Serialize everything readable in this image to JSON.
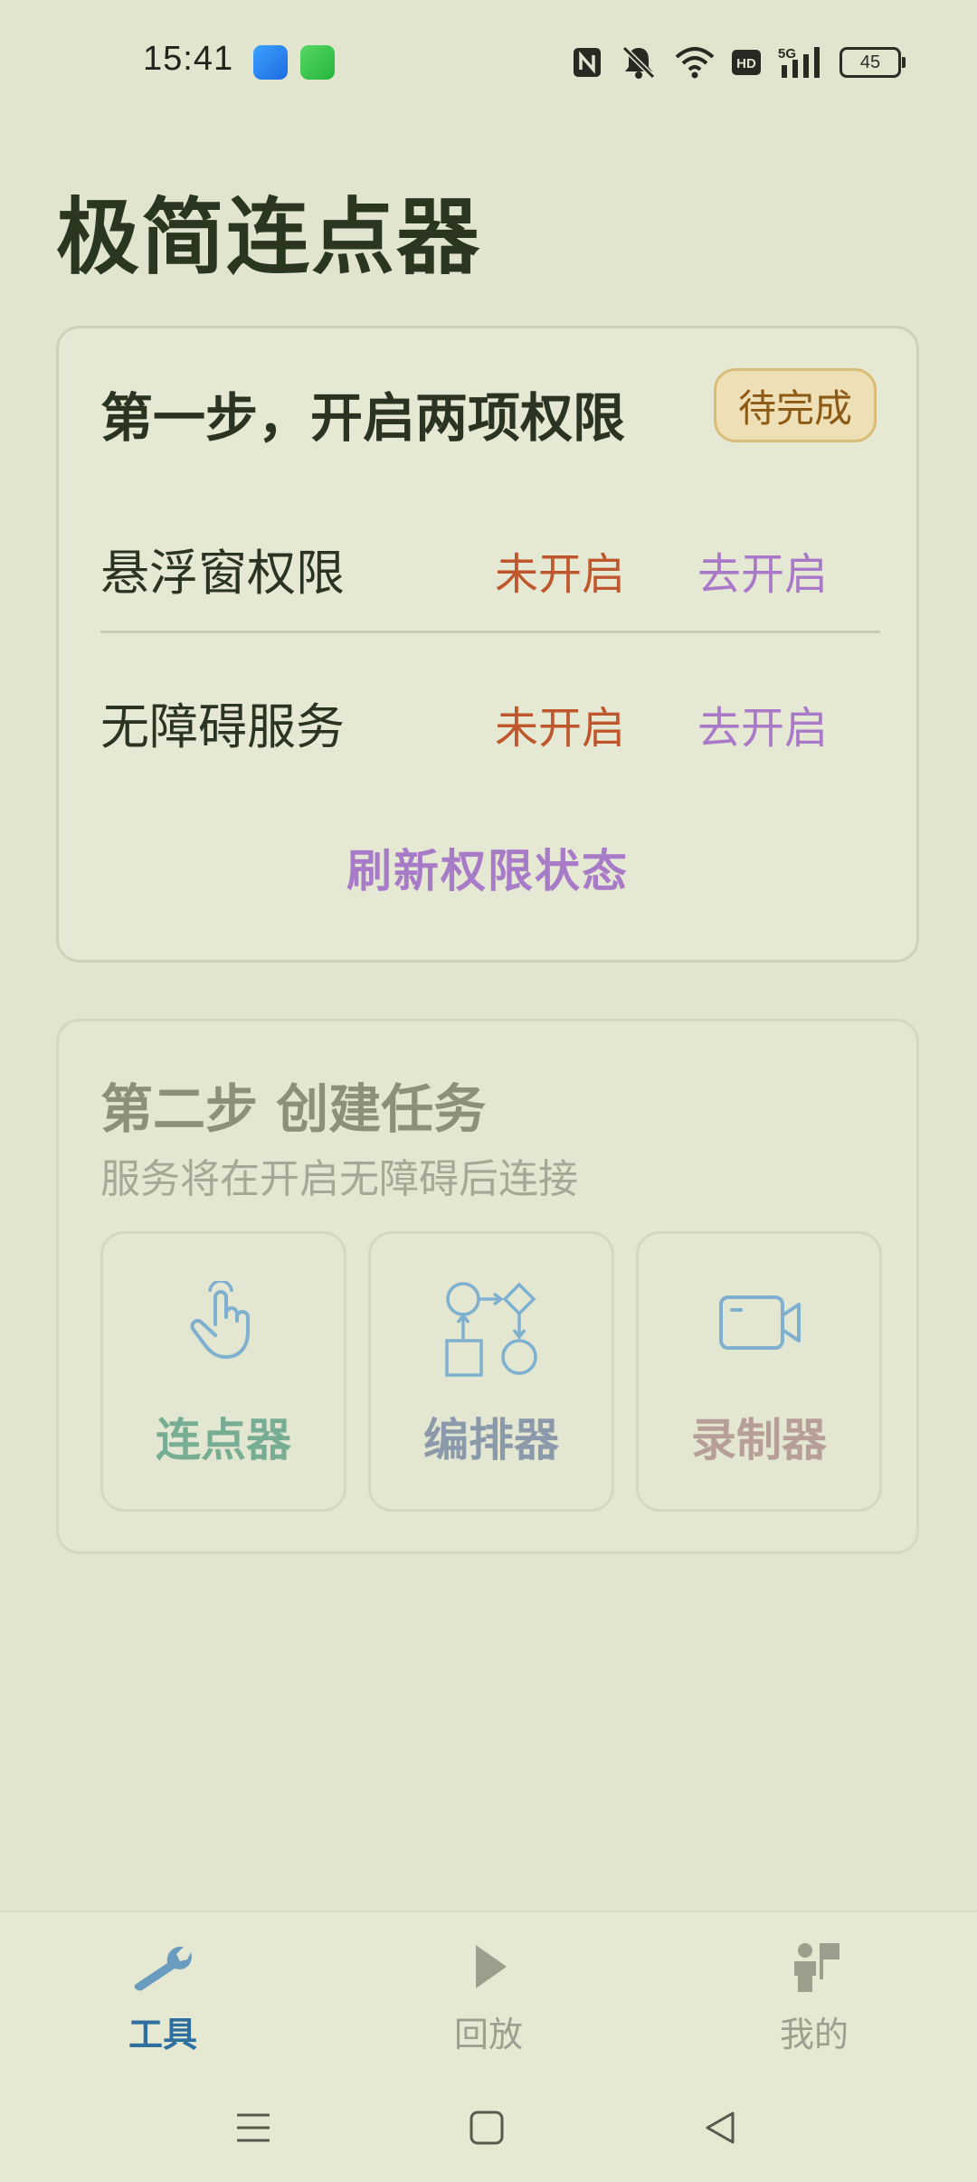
{
  "status_bar": {
    "time": "15:41",
    "battery": "45",
    "icons": [
      "hotspot-app-icon",
      "messages-app-icon",
      "nfc-icon",
      "mute-icon",
      "wifi-icon",
      "hd-icon",
      "signal-5g-icon",
      "battery-icon"
    ]
  },
  "app": {
    "title": "极简连点器"
  },
  "step1": {
    "title": "第一步，开启两项权限",
    "badge": "待完成",
    "permissions": [
      {
        "name": "悬浮窗权限",
        "status": "未开启",
        "action": "去开启"
      },
      {
        "name": "无障碍服务",
        "status": "未开启",
        "action": "去开启"
      }
    ],
    "refresh_label": "刷新权限状态",
    "colors": {
      "status": "#c0562b",
      "action": "#a978c9",
      "badge_bg": "#efdfb7"
    }
  },
  "step2": {
    "title": "第二步 创建任务",
    "subtitle": "服务将在开启无障碍后连接",
    "tools": [
      {
        "label": "连点器",
        "icon": "tap-hand-icon"
      },
      {
        "label": "编排器",
        "icon": "flowchart-icon"
      },
      {
        "label": "录制器",
        "icon": "video-camera-icon"
      }
    ]
  },
  "bottom_nav": {
    "items": [
      {
        "label": "工具",
        "icon": "wrench-icon",
        "active": true
      },
      {
        "label": "回放",
        "icon": "play-icon",
        "active": false
      },
      {
        "label": "我的",
        "icon": "person-flag-icon",
        "active": false
      }
    ],
    "active_color": "#2f6f9f"
  },
  "system_nav": {
    "buttons": [
      "menu-icon",
      "home-icon",
      "back-icon"
    ]
  }
}
